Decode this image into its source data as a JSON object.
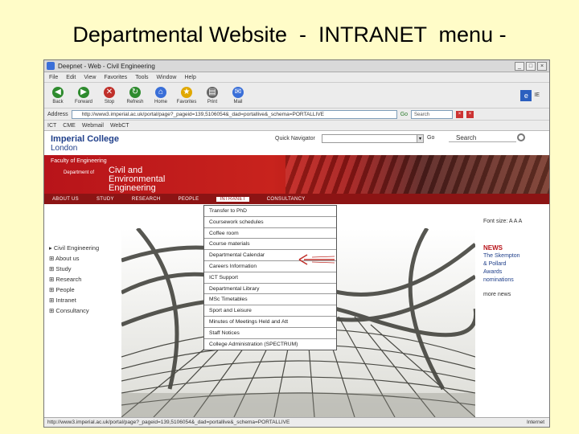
{
  "slide": {
    "title": "Departmental Website  -  INTRANET  menu -"
  },
  "window": {
    "title": "Deepnet - Web - Civil Engineering"
  },
  "menubar": [
    "File",
    "Edit",
    "View",
    "Favorites",
    "Tools",
    "Window",
    "Help"
  ],
  "toolbar": [
    {
      "label": "Back",
      "icon": "back-icon",
      "glyph": "◀",
      "color": "#2e8b2e"
    },
    {
      "label": "Forward",
      "icon": "forward-icon",
      "glyph": "▶",
      "color": "#2e8b2e"
    },
    {
      "label": "Stop",
      "icon": "stop-icon",
      "glyph": "✕",
      "color": "#c0302a"
    },
    {
      "label": "Refresh",
      "icon": "refresh-icon",
      "glyph": "↻",
      "color": "#2e8b2e"
    },
    {
      "label": "Home",
      "icon": "home-icon",
      "glyph": "⌂",
      "color": "#3a6fd8"
    },
    {
      "label": "Favorites",
      "icon": "favorites-icon",
      "glyph": "★",
      "color": "#e0a800"
    },
    {
      "label": "Print",
      "icon": "print-icon",
      "glyph": "▤",
      "color": "#666666"
    },
    {
      "label": "Mail",
      "icon": "mail-icon",
      "glyph": "✉",
      "color": "#3a6fd8"
    }
  ],
  "toolbar_right": {
    "label": "IE"
  },
  "address": {
    "label": "Address",
    "url": "http://www3.imperial.ac.uk/portal/page?_pageid=139,5106054&_dad=portallive&_schema=PORTALLIVE",
    "go": "Go",
    "search_placeholder": "Search"
  },
  "links": [
    "ICT",
    "CME",
    "Webmail",
    "WebCT"
  ],
  "site": {
    "logo_line1": "Imperial College",
    "logo_line2": "London",
    "quick_nav": "Quick Navigator",
    "go": "Go",
    "search": "Search",
    "faculty": "Faculty of Engineering",
    "department_of": "Department of",
    "department_name": "Civil and Environmental Engineering",
    "nav": [
      "ABOUT US",
      "STUDY",
      "RESEARCH",
      "PEOPLE",
      "INTRANET",
      "CONSULTANCY"
    ],
    "sidenav": [
      "Civil Engineering",
      "About us",
      "Study",
      "Research",
      "People",
      "Intranet",
      "Consultancy"
    ],
    "font_size": "Font size:",
    "news_heading": "NEWS",
    "news_items": [
      "The Skempton",
      "& Pollard",
      "Awards",
      "nominations"
    ],
    "news_more": "more news"
  },
  "intranet_menu": [
    "Transfer to PhD",
    "Coursework schedules",
    "Coffee room",
    "Course materials",
    "Departmental Calendar",
    "Careers Information",
    "ICT Support",
    "Departmental Library",
    "MSc Timetables",
    "Sport and Leisure",
    "Minutes of Meetings Held and Att",
    "Staff Notices",
    "College Administration (SPECTRUM)"
  ],
  "status": {
    "text": "http://www3.imperial.ac.uk/portal/page?_pageid=139,5106054&_dad=portallive&_schema=PORTALLIVE",
    "zone": "Internet"
  }
}
